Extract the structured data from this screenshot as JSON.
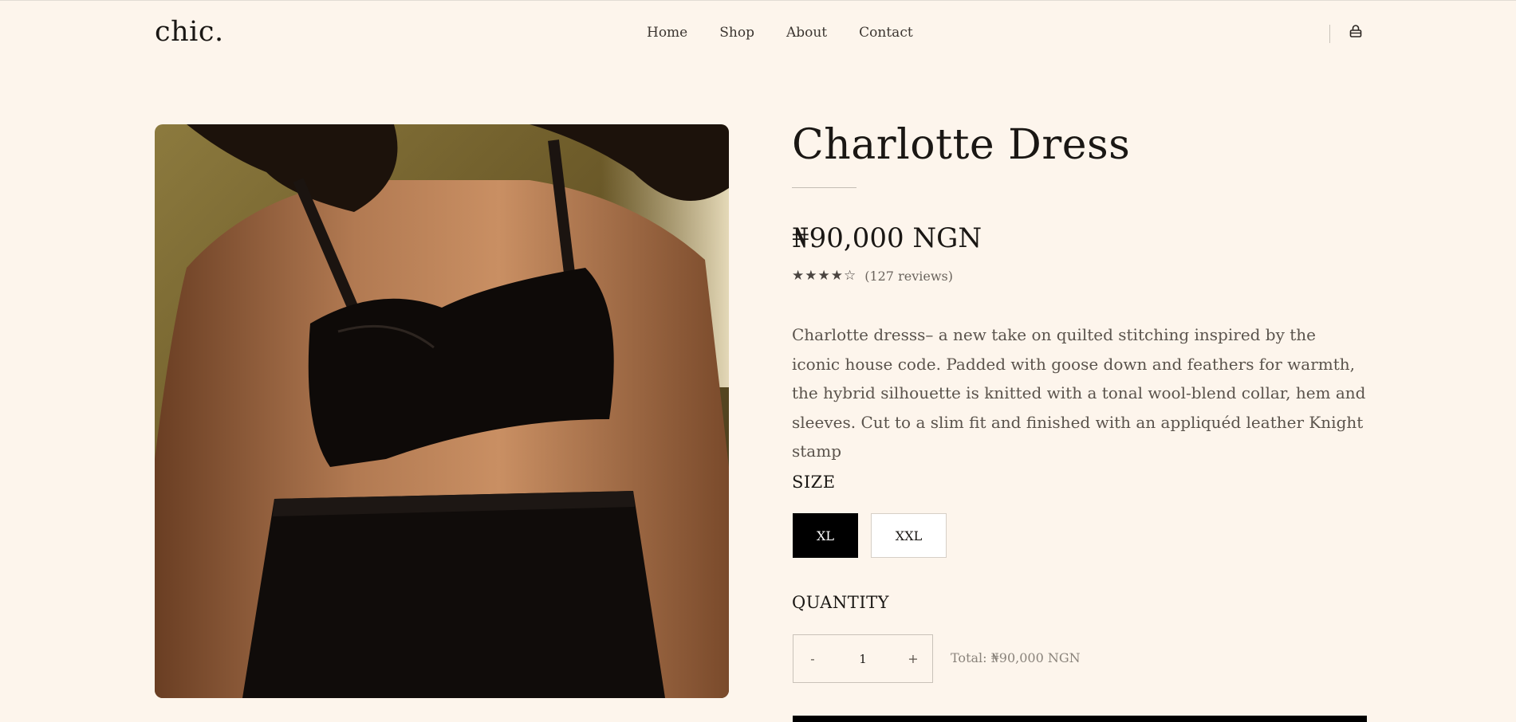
{
  "header": {
    "logo": "chic.",
    "nav": [
      {
        "label": "Home"
      },
      {
        "label": "Shop"
      },
      {
        "label": "About"
      },
      {
        "label": "Contact"
      }
    ],
    "cart_icon": "shopping-bag-icon"
  },
  "product": {
    "title": "Charlotte Dress",
    "price": "₦90,000 NGN",
    "rating": {
      "stars_filled": 4,
      "stars_total": 5,
      "stars_text": "★★★★☆",
      "reviews_text": "(127 reviews)"
    },
    "description": "Charlotte dresss– a new take on quilted stitching inspired by the iconic house code. Padded with goose down and feathers for warmth, the hybrid silhouette is knitted with a tonal wool-blend collar, hem and sleeves. Cut to a slim fit and finished with an appliquéd leather Knight stamp",
    "size": {
      "label": "SIZE",
      "options": [
        "XL",
        "XXL"
      ],
      "selected": "XL"
    },
    "quantity": {
      "label": "QUANTITY",
      "minus": "-",
      "value": "1",
      "plus": "+",
      "total_text": "Total: ₦90,000 NGN"
    }
  },
  "colors": {
    "background": "#fdf5ec",
    "text": "#1a1714",
    "selected_size_bg": "#000000",
    "button_bg": "#000000"
  }
}
